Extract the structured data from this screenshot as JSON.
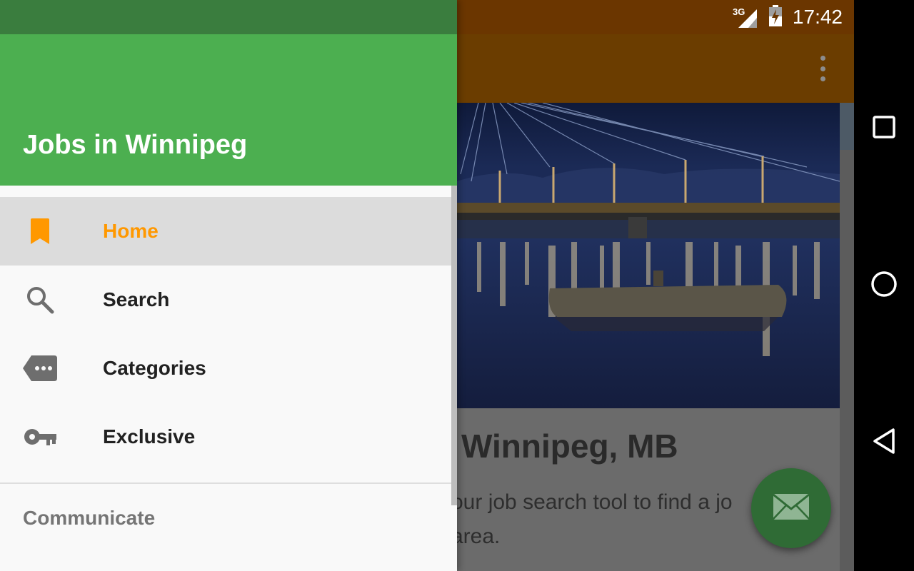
{
  "status_bar": {
    "network": "3G",
    "time": "17:42"
  },
  "drawer": {
    "title": "Jobs in Winnipeg",
    "items": [
      {
        "label": "Home",
        "icon": "bookmark-icon",
        "active": true
      },
      {
        "label": "Search",
        "icon": "search-icon",
        "active": false
      },
      {
        "label": "Categories",
        "icon": "label-more-icon",
        "active": false
      },
      {
        "label": "Exclusive",
        "icon": "key-icon",
        "active": false
      }
    ],
    "section_label": "Communicate"
  },
  "content": {
    "title_visible": "Winnipeg, MB",
    "text_line1": "our job search tool to find a jo",
    "text_line2": "area."
  },
  "fab": {
    "icon": "mail-icon"
  },
  "colors": {
    "drawer_header": "#4caf50",
    "drawer_status": "#3a7d3e",
    "accent": "#ff9800",
    "fab": "#2f6b35",
    "toolbar_dimmed": "#6b3d00"
  },
  "navigation_bar": {
    "buttons": [
      "recents-icon",
      "home-icon",
      "back-icon"
    ]
  }
}
